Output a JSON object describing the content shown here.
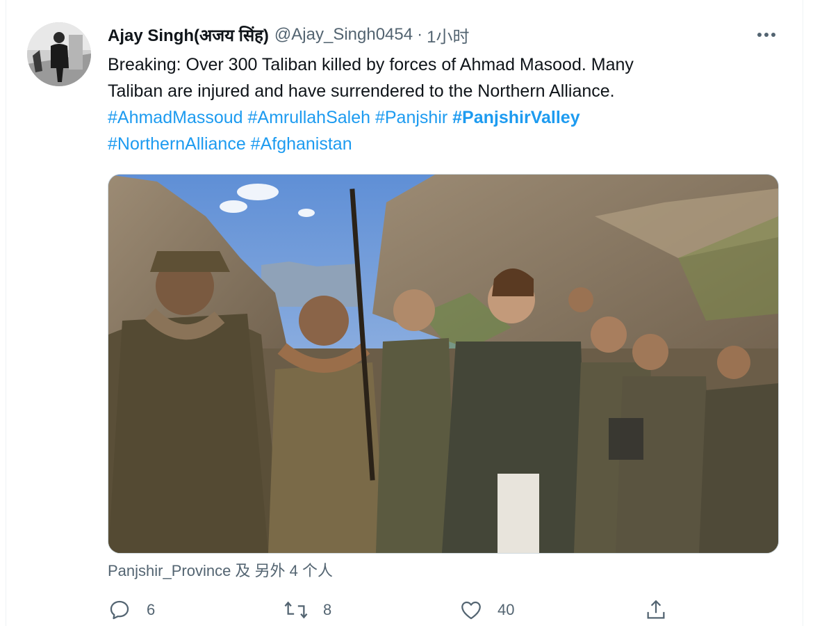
{
  "tweet": {
    "author_name": "Ajay Singh(अजय सिंह)",
    "handle": "@Ajay_Singh0454",
    "separator": "·",
    "time": "1小时",
    "text_line1": "Breaking: Over 300 Taliban killed by forces of Ahmad Masood. Many",
    "text_line2": "Taliban are injured and have surrendered to the Northern Alliance.",
    "hashtags_line1": [
      "#AhmadMassoud",
      "#AmrullahSaleh",
      "#Panjshir",
      "#PanjshirValley"
    ],
    "hashtags_line2": [
      "#NorthernAlliance",
      "#Afghanistan"
    ],
    "tagged_people": "Panjshir_Province 及 另外 4 个人"
  },
  "actions": {
    "reply_count": "6",
    "retweet_count": "8",
    "like_count": "40"
  },
  "icons": {
    "more": "more-horizontal-icon",
    "reply": "reply-icon",
    "retweet": "retweet-icon",
    "like": "heart-icon",
    "share": "share-icon"
  },
  "colors": {
    "link": "#1d9bf0",
    "secondary_text": "#536471",
    "primary_text": "#0f1419"
  }
}
